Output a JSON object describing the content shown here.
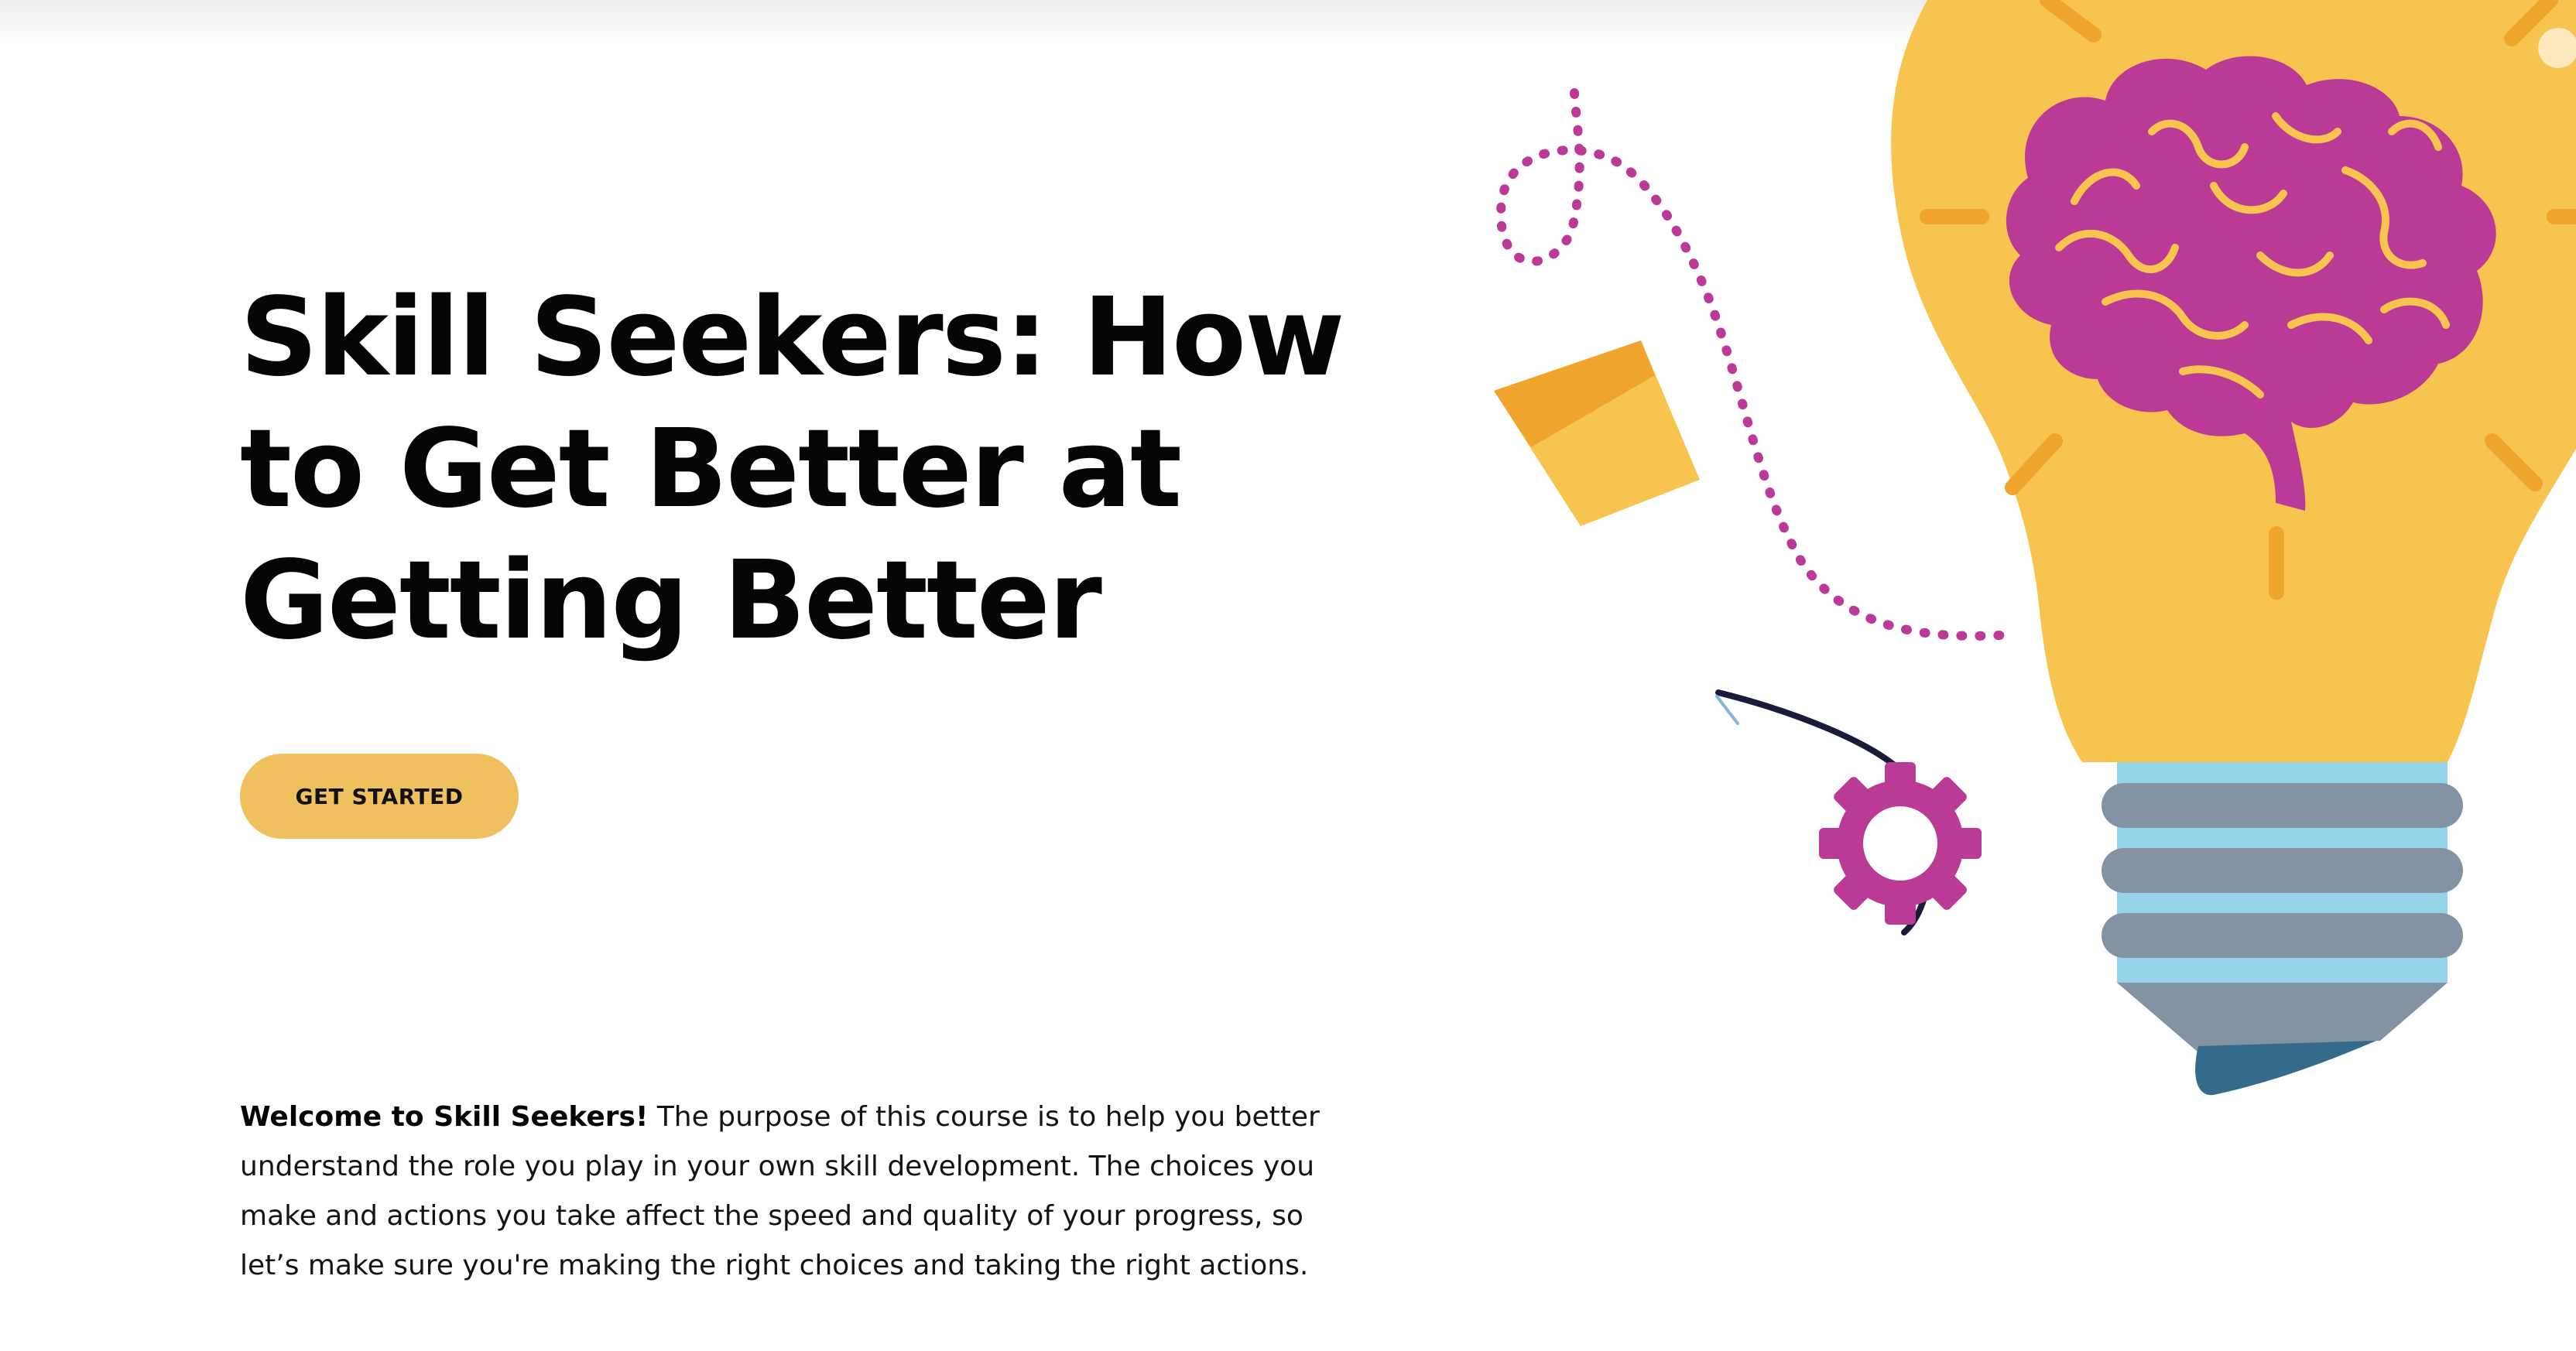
{
  "hero": {
    "title": "Skill Seekers: How to Get Better at Getting Better",
    "cta_label": "GET STARTED"
  },
  "intro": {
    "lead": "Welcome to Skill Seekers!",
    "body": " The purpose of this course is to help you better understand the role you play in your own skill development. The choices you make and actions you take affect the speed and quality of your progress, so let’s make sure you're making the right choices and taking the right actions."
  },
  "illustration": {
    "icons": [
      "lightbulb-icon",
      "brain-icon",
      "gear-icon",
      "paper-note-icon",
      "dotted-path-icon"
    ],
    "colors": {
      "bulb": "#f8c450",
      "bulb_rays": "#eea42d",
      "brain": "#bb3a96",
      "brain_folds": "#f8c450",
      "base_stripes": "#8c9aa8",
      "base_light": "#94d3e8",
      "base_tip": "#356b8a",
      "gear": "#bb3a96",
      "path": "#bb3a96",
      "note_front": "#f8c450",
      "note_flap": "#eea42d"
    }
  },
  "theme": {
    "accent": "#efc05e",
    "text": "#050505",
    "background": "#ffffff"
  }
}
